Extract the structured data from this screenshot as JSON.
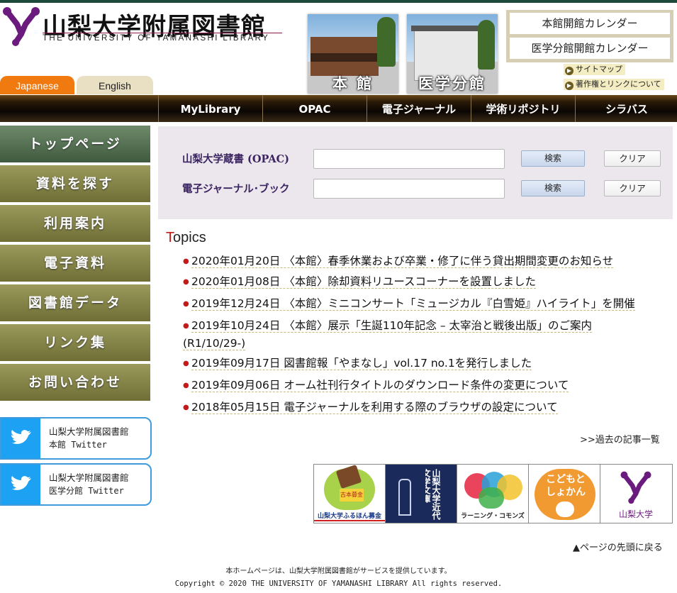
{
  "header": {
    "logo_title": "山梨大学附属図書館",
    "logo_subtitle": "THE UNIVERSITY OF YAMANASHI LIBRARY",
    "lang_japanese": "Japanese",
    "lang_english": "English",
    "photo_main_caption": "本 館",
    "photo_medical_caption": "医学分館",
    "calendar_main": "本館開館カレンダー",
    "calendar_medical": "医学分館開館カレンダー",
    "sitemap": "サイトマップ",
    "copyright_link": "著作権とリンクについて"
  },
  "nav": {
    "items": [
      "MyLibrary",
      "OPAC",
      "電子ジャーナル",
      "学術リポジトリ",
      "シラバス"
    ]
  },
  "sidebar": {
    "items": [
      "トップページ",
      "資料を探す",
      "利用案内",
      "電子資料",
      "図書館データ",
      "リンク集",
      "お問い合わせ"
    ],
    "twitter_main_line1": "山梨大学附属図書館",
    "twitter_main_line2": "本館 Twitter",
    "twitter_med_line1": "山梨大学附属図書館",
    "twitter_med_line2": "医学分館 Twitter"
  },
  "search": {
    "opac_label": "山梨大学蔵書 (OPAC)",
    "ej_label": "電子ジャーナル･ブック",
    "opac_value": "",
    "ej_value": "",
    "search_button": "検索",
    "clear_button": "クリア"
  },
  "topics": {
    "title_first": "T",
    "title_rest": "opics",
    "items": [
      "2020年01月20日 〈本館〉春季休業および卒業・修了に伴う貸出期間変更のお知らせ",
      "2020年01月08日 〈本館〉除却資料リユースコーナーを設置しました",
      "2019年12月24日 〈本館〉ミニコンサート「ミュージカル『白雪姫』ハイライト」を開催",
      "2019年10月24日 〈本館〉展示「生誕110年記念 – 太宰治と戦後出版」のご案内(R1/10/29-)",
      "2019年09月17日 図書館報「やまなし」vol.17 no.1を発行しました",
      "2019年09月06日 オーム社刊行タイトルのダウンロード条件の変更について",
      "2018年05月15日 電子ジャーナルを利用する際のブラウザの設定について"
    ],
    "more": ">>過去の記事一覧"
  },
  "banners": {
    "b1_text": "山梨大学ふるほん募金",
    "b1_badge": "古本募金",
    "b2_text": "山梨大学近代文学文庫",
    "b3_text": "ラーニング・コモンズ",
    "b4_text": "こどもとしょかん",
    "b5_text": "山梨大学"
  },
  "footer": {
    "pagetop": "▲ページの先頭に戻る",
    "service": "本ホームページは、山梨大学附属図書館がサービスを提供しています。",
    "copyright": "Copyright © 2020  THE UNIVERSITY OF YAMANASHI LIBRARY All rights reserved."
  },
  "colors": {
    "accent_orange": "#f07a10",
    "sidebar_olive": "#7f7e42",
    "twitter_blue": "#1da1f2",
    "topic_red": "#c41a1a"
  }
}
